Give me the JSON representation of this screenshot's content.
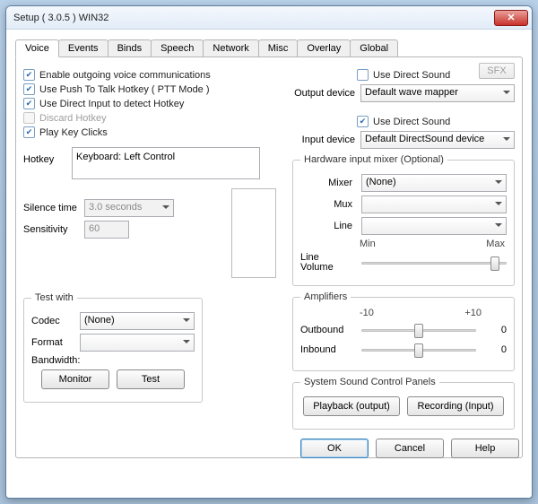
{
  "window": {
    "title": "Setup ( 3.0.5 ) WIN32"
  },
  "tabs": [
    "Voice",
    "Events",
    "Binds",
    "Speech",
    "Network",
    "Misc",
    "Overlay",
    "Global"
  ],
  "active_tab": 0,
  "left": {
    "chk_enable": {
      "label": "Enable outgoing voice communications",
      "checked": true
    },
    "chk_ptt": {
      "label": "Use Push To Talk Hotkey ( PTT Mode )",
      "checked": true
    },
    "chk_direct": {
      "label": "Use Direct Input to detect Hotkey",
      "checked": true
    },
    "chk_discard": {
      "label": "Discard Hotkey",
      "checked": false,
      "disabled": true
    },
    "chk_clicks": {
      "label": "Play Key Clicks",
      "checked": true
    },
    "hotkey_label": "Hotkey",
    "hotkey_value": "Keyboard: Left Control",
    "silence_label": "Silence time",
    "silence_value": "3.0 seconds",
    "sensitivity_label": "Sensitivity",
    "sensitivity_value": "60",
    "testwith": {
      "legend": "Test with",
      "codec_label": "Codec",
      "codec_value": "(None)",
      "format_label": "Format",
      "format_value": "",
      "bandwidth_label": "Bandwidth:",
      "monitor_btn": "Monitor",
      "test_btn": "Test"
    }
  },
  "right": {
    "sfx_btn": "SFX",
    "out_direct": {
      "label": "Use Direct Sound",
      "checked": false
    },
    "out_device_label": "Output device",
    "out_device_value": "Default wave mapper",
    "in_direct": {
      "label": "Use Direct Sound",
      "checked": true
    },
    "in_device_label": "Input device",
    "in_device_value": "Default DirectSound device",
    "mixer": {
      "legend": "Hardware input mixer (Optional)",
      "mixer_label": "Mixer",
      "mixer_value": "(None)",
      "mux_label": "Mux",
      "mux_value": "",
      "line_label": "Line",
      "line_value": "",
      "min": "Min",
      "max": "Max",
      "linevol_label": "Line Volume",
      "linevol_pos": 0.92
    },
    "amplifiers": {
      "legend": "Amplifiers",
      "range_min": "-10",
      "range_max": "+10",
      "outbound_label": "Outbound",
      "outbound_pos": 0.5,
      "outbound_val": "0",
      "inbound_label": "Inbound",
      "inbound_pos": 0.5,
      "inbound_val": "0"
    },
    "syspanels": {
      "legend": "System Sound Control Panels",
      "playback_btn": "Playback (output)",
      "recording_btn": "Recording (Input)"
    }
  },
  "footer": {
    "ok": "OK",
    "cancel": "Cancel",
    "help": "Help"
  }
}
